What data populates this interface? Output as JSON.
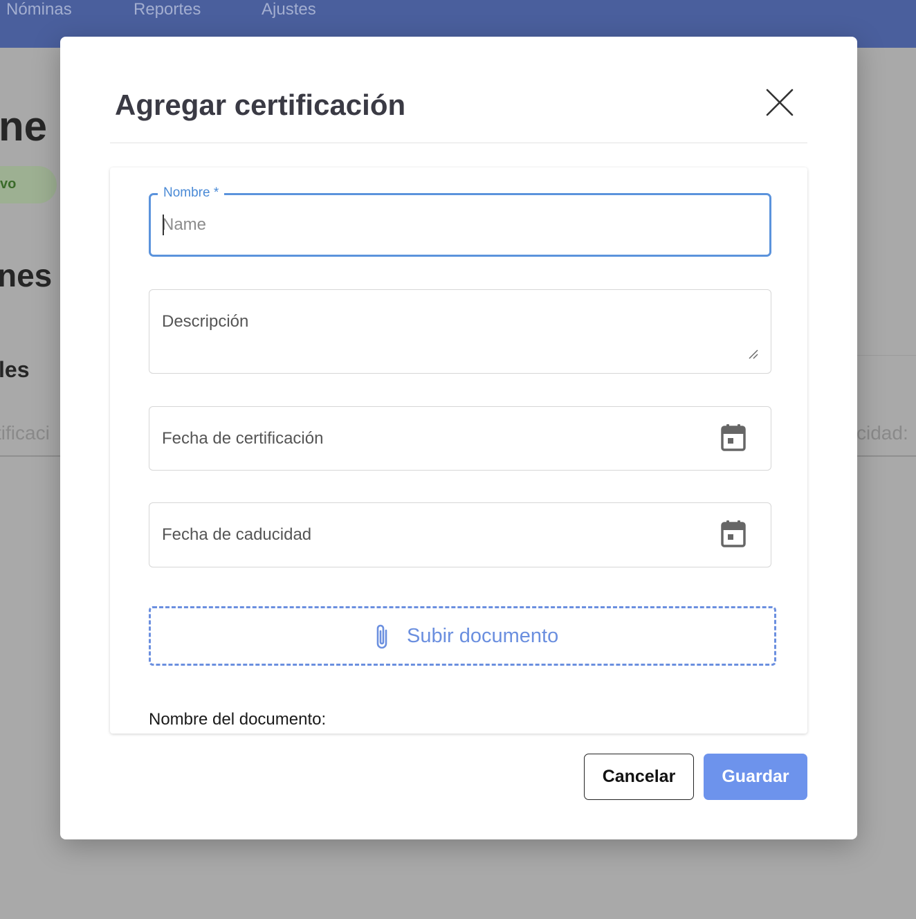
{
  "background": {
    "nav": [
      "Nóminas",
      "Reportes",
      "Ajustes"
    ],
    "title_fragment": "ne",
    "badge_fragment": "vo",
    "heading_fragment": "nes",
    "subheading_fragment": "les",
    "row_left_fragment": "tificaci",
    "row_right_fragment": "cidad:"
  },
  "modal": {
    "title": "Agregar certificación",
    "fields": {
      "name_label": "Nombre *",
      "name_placeholder": "Name",
      "name_value": "",
      "description_label": "Descripción",
      "cert_date_label": "Fecha de certificación",
      "expiry_date_label": "Fecha de caducidad"
    },
    "upload_label": "Subir documento",
    "doc_name_label": "Nombre del documento:",
    "buttons": {
      "cancel": "Cancelar",
      "save": "Guardar"
    }
  },
  "colors": {
    "nav_bg": "#4a5f9d",
    "accent": "#6d93ec",
    "focus_border": "#5b93dc",
    "upload_dash": "#6b8fdf"
  },
  "icons": [
    "close-icon",
    "calendar-icon",
    "paperclip-icon",
    "resize-handle-icon"
  ]
}
